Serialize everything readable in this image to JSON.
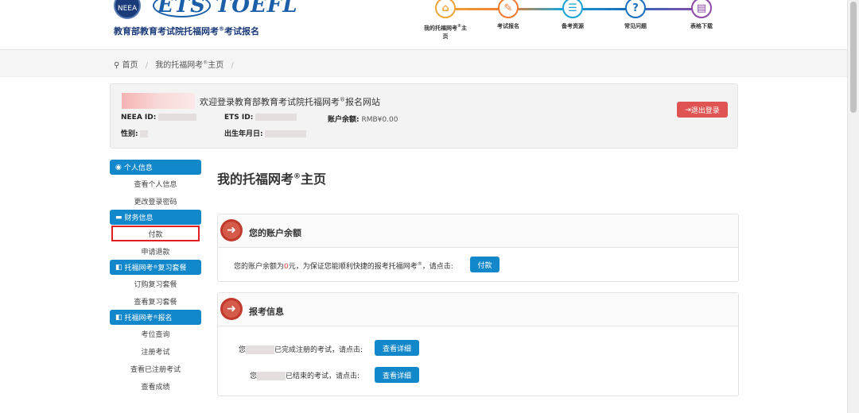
{
  "header": {
    "neea_logo_text": "NEEA",
    "ets_logo_text": "ETS",
    "toefl_logo_text": "TOEFL",
    "brand_subtitle": "教育部教育考试院托福网考",
    "brand_subtitle_sup": "®",
    "brand_subtitle_tail": "考试报名",
    "steps": [
      {
        "label": "我的托福网考",
        "sup": "®",
        "tail": "主",
        "line2": "页",
        "icon": "home-icon",
        "color": "#f0a43a",
        "glyph": "⌂"
      },
      {
        "label": "考试报名",
        "icon": "pencil-icon",
        "color": "#ee7b2f",
        "glyph": "✎"
      },
      {
        "label": "备考资源",
        "icon": "document-list-icon",
        "color": "#1ca3d6",
        "glyph": "☰"
      },
      {
        "label": "常见问题",
        "icon": "question-icon",
        "color": "#1a6fc0",
        "glyph": "?"
      },
      {
        "label": "表格下载",
        "icon": "form-download-icon",
        "color": "#8c4aa5",
        "glyph": "▤"
      }
    ]
  },
  "breadcrumb": {
    "home": "首页",
    "current": "我的托福网考",
    "current_sup": "®",
    "current_tail": "主页",
    "separator": "/"
  },
  "welcome": {
    "message": "欢迎登录教育部教育考试院托福网考",
    "message_sup": "®",
    "message_tail": "报名网站",
    "neea_id_label": "NEEA ID:",
    "ets_id_label": "ETS ID:",
    "balance_label": "账户余额:",
    "balance_value": "RMB¥0.00",
    "gender_label": "性别:",
    "dob_label": "出生年月日:",
    "logout_label": "退出登录"
  },
  "sidebar": {
    "sections": [
      {
        "title": "个人信息",
        "items": [
          "查看个人信息",
          "更改登录密码"
        ]
      },
      {
        "title": "财务信息",
        "items": [
          "付款",
          "申请退款"
        ]
      },
      {
        "title": "托福网考",
        "title_sup": "®",
        "title_tail": "复习套餐",
        "items": [
          "订购复习套餐",
          "查看复习套餐"
        ]
      },
      {
        "title": "托福网考",
        "title_sup": "®",
        "title_tail": "报名",
        "items": [
          "考位查询",
          "注册考试",
          "查看已注册考试",
          "查看成绩"
        ]
      }
    ]
  },
  "main": {
    "title": "我的托福网考",
    "title_sup": "®",
    "title_tail": "主页",
    "balance_panel": {
      "heading": "您的账户余额",
      "text_pre": "您的账户余额为",
      "amount": "0",
      "text_mid": "元，为保证您能顺利快捷的报考托福网考",
      "text_sup": "®",
      "text_tail": "，请点击:",
      "button": "付款"
    },
    "exam_panel": {
      "heading": "报考信息",
      "row1_pre": "您",
      "row1_text": "已完成注册的考试，请点击:",
      "row1_button": "查看详细",
      "row2_pre": "您",
      "row2_text": "已结束的考试，请点击:",
      "row2_button": "查看详细"
    }
  }
}
